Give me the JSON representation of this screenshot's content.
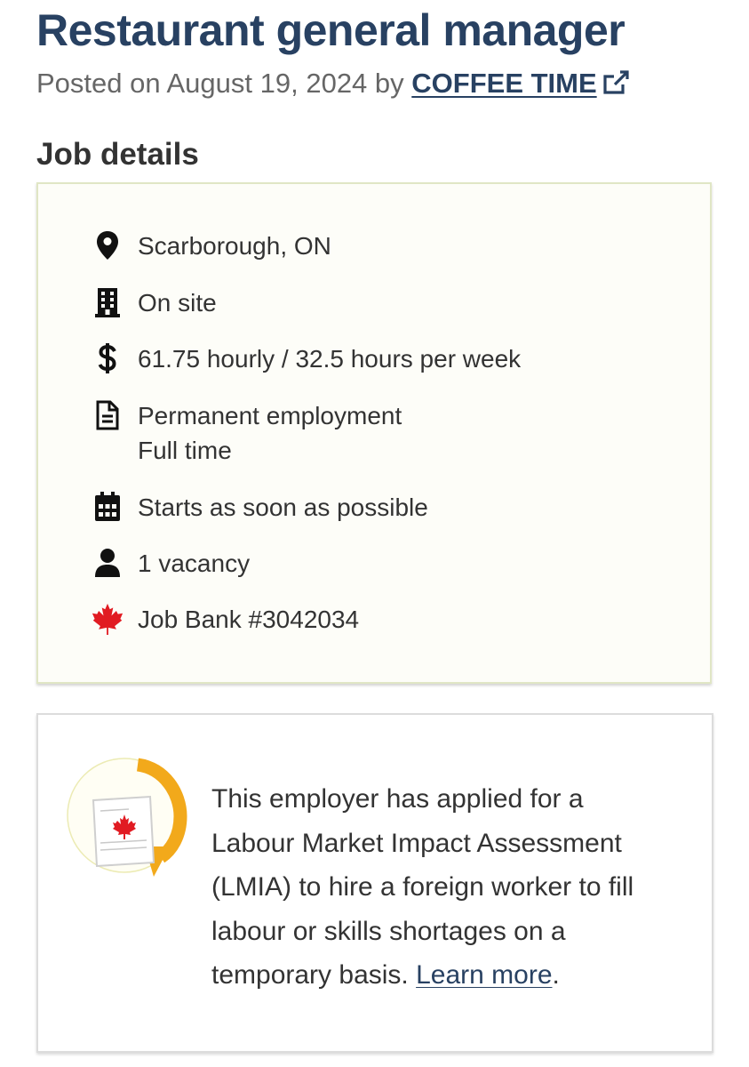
{
  "job": {
    "title": "Restaurant general manager",
    "posted_prefix": "Posted on August 19, 2024 by ",
    "employer": "COFFEE TIME"
  },
  "details": {
    "heading": "Job details",
    "location": "Scarborough, ON",
    "work_site": "On site",
    "salary": "61.75 hourly / 32.5 hours per week",
    "employment_type": "Permanent employment",
    "employment_schedule": "Full time",
    "start": "Starts as soon as possible",
    "vacancies": "1 vacancy",
    "job_bank_number": "Job Bank #3042034"
  },
  "icons": {
    "location": "map-marker-icon",
    "work_site": "building-icon",
    "salary": "dollar-icon",
    "employment": "document-icon",
    "start": "calendar-icon",
    "vacancies": "person-icon",
    "job_bank": "maple-leaf-icon",
    "employer_link": "external-link-icon",
    "lmia": "lmia-document-icon"
  },
  "lmia": {
    "text": "This employer has applied for a Labour Market Impact Assessment (LMIA) to hire a foreign worker to fill labour or skills shortages on a temporary basis. ",
    "link_label": "Learn more",
    "suffix": "."
  },
  "colors": {
    "title": "#284162",
    "link": "#284162",
    "details_background": "#fdfdf8",
    "details_border": "#e0e6c5",
    "maple_leaf": "#e11b22",
    "lmia_arrow": "#f2a91b"
  }
}
